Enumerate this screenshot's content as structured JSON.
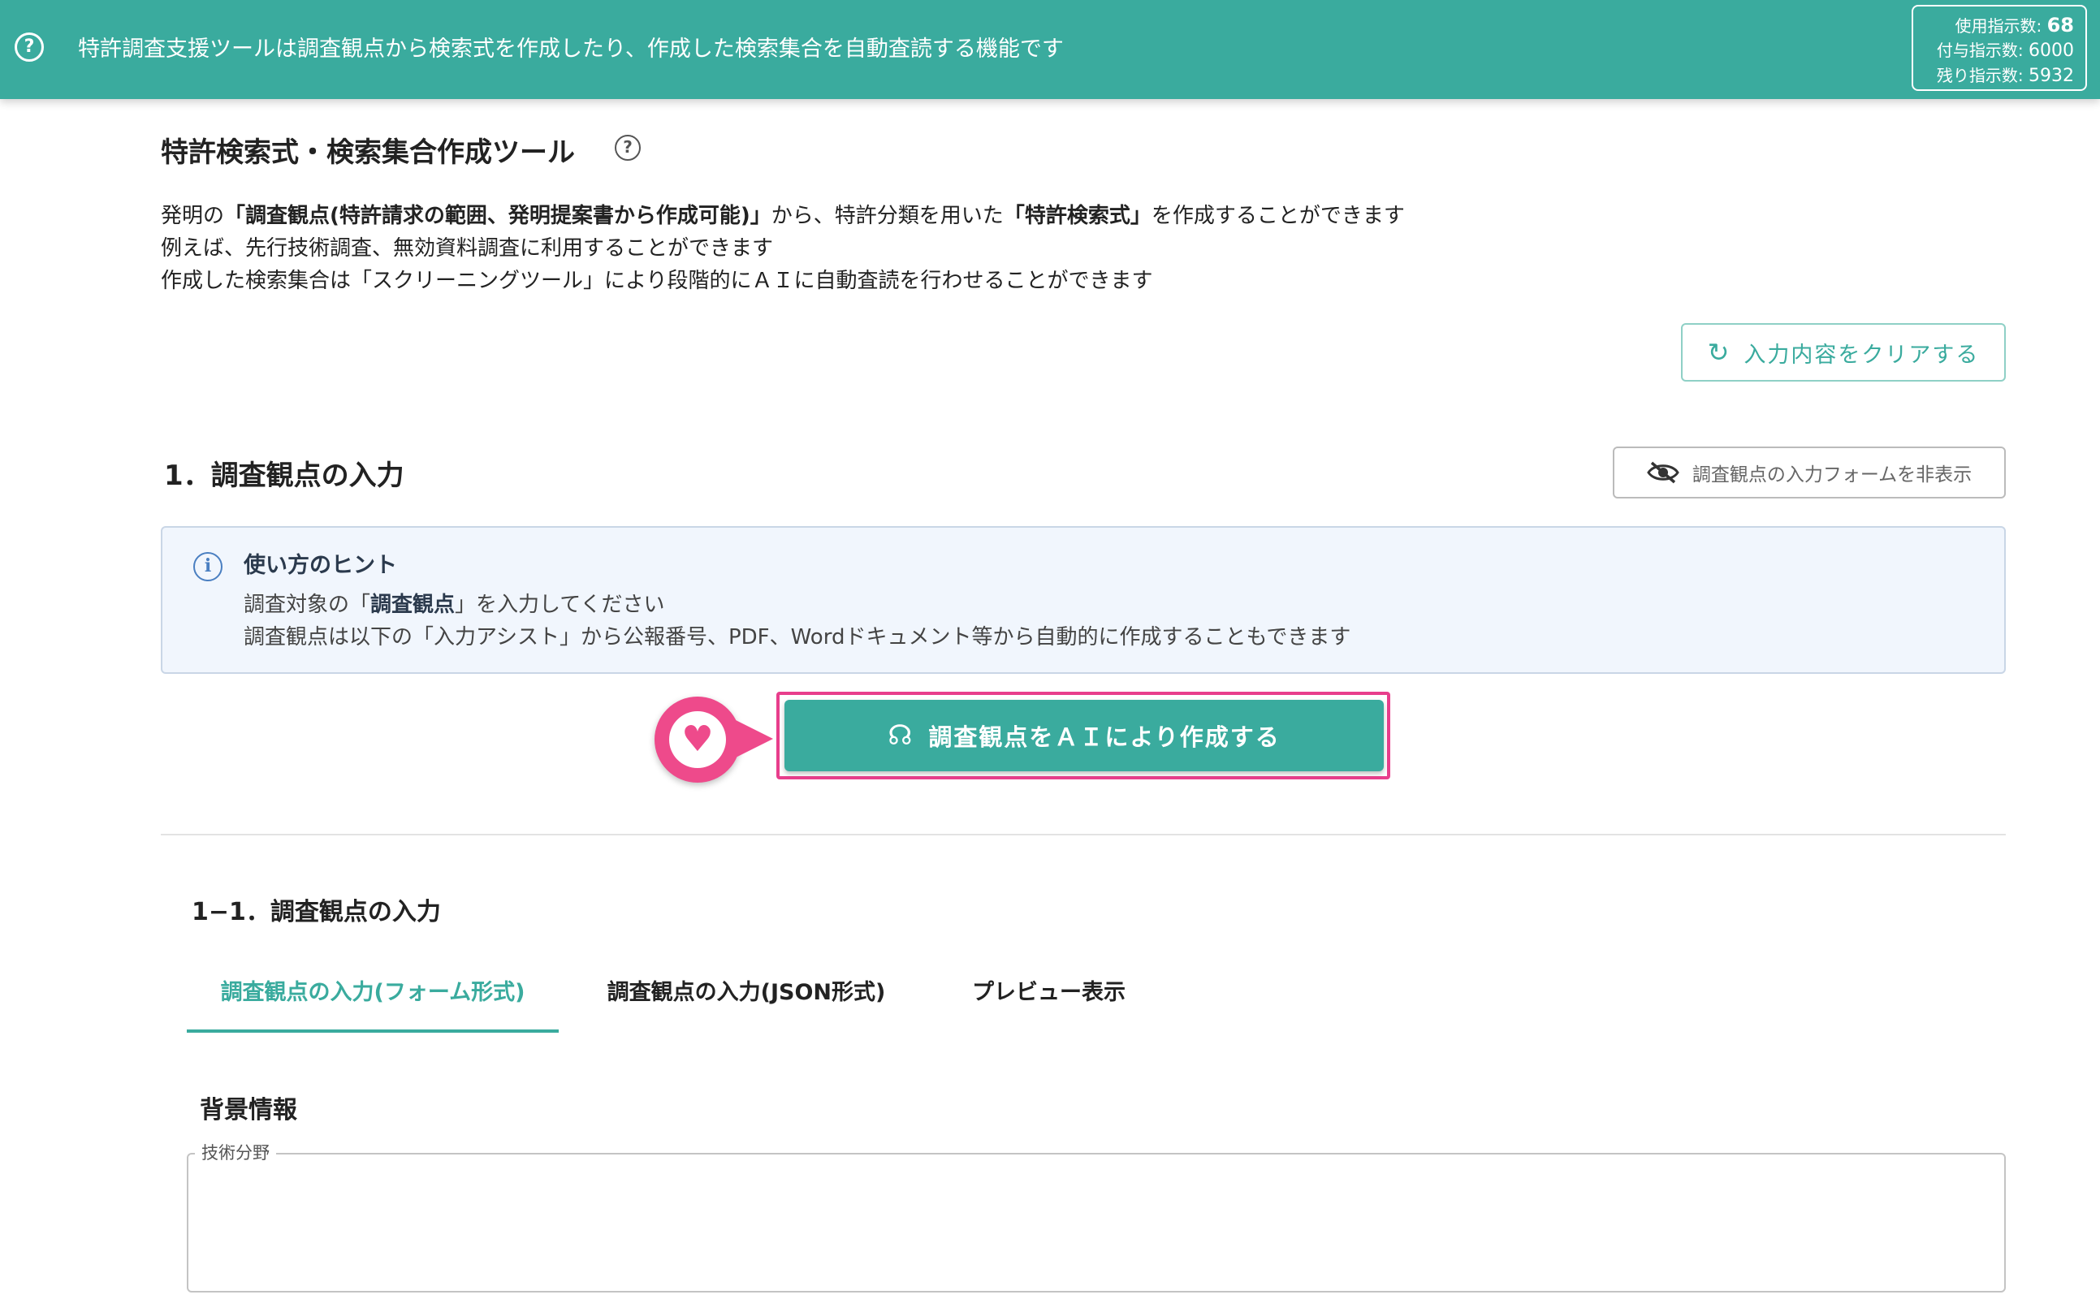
{
  "topbar": {
    "help_icon": "question-circle-icon",
    "help_glyph": "?",
    "description": "特許調査支援ツールは調査観点から検索式を作成したり、作成した検索集合を自動査読する機能です",
    "counters": {
      "used_label": "使用指示数:",
      "used_value": "68",
      "granted_label": "付与指示数:",
      "granted_value": "6000",
      "remaining_label": "残り指示数:",
      "remaining_value": "5932"
    }
  },
  "page": {
    "title": "特許検索式・検索集合作成ツール",
    "help_glyph": "?",
    "intro": {
      "line1_pre": "発明の",
      "line1_bold1": "「調査観点(特許請求の範囲、発明提案書から作成可能)」",
      "line1_mid": "から、特許分類を用いた",
      "line1_bold2": "「特許検索式」",
      "line1_post": "を作成することができます",
      "line2": "例えば、先行技術調査、無効資料調査に利用することができます",
      "line3": "作成した検索集合は「スクリーニングツール」により段階的にＡＩに自動査読を行わせることができます"
    },
    "clear_button": "入力内容をクリアする"
  },
  "section1": {
    "title": "1．調査観点の入力",
    "hide_form_button": "調査観点の入力フォームを非表示",
    "hint": {
      "icon_glyph": "i",
      "title": "使い方のヒント",
      "line1_pre": "調査対象の「",
      "line1_bold": "調査観点",
      "line1_post": "」を入力してください",
      "line2": "調査観点は以下の「入力アシスト」から公報番号、PDF、Wordドキュメント等から自動的に作成することもできます"
    },
    "ai_button": "調査観点をＡＩにより作成する"
  },
  "section11": {
    "title": "1−1．調査観点の入力",
    "tabs": [
      {
        "label": "調査観点の入力(フォーム形式)",
        "active": true
      },
      {
        "label": "調査観点の入力(JSON形式)",
        "active": false
      },
      {
        "label": "プレビュー表示",
        "active": false
      }
    ],
    "background_title": "背景情報",
    "tech_field_label": "技術分野",
    "tech_field_value": ""
  },
  "colors": {
    "accent": "#3aab9e",
    "highlight": "#e83e8c",
    "hint_bg": "#f1f6fd"
  }
}
